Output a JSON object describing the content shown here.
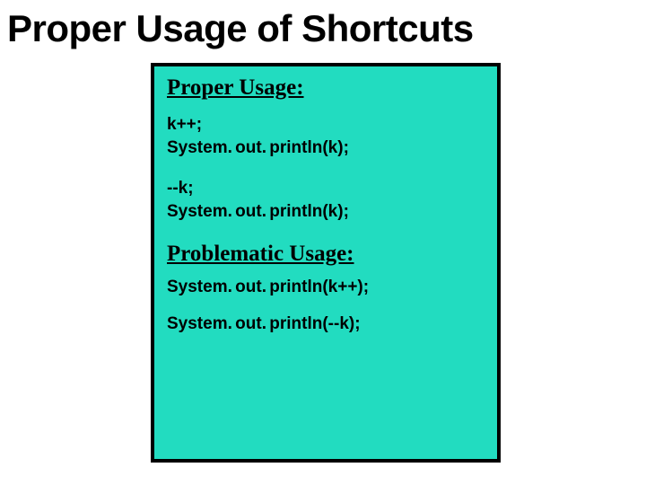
{
  "title": "Proper Usage of Shortcuts",
  "sections": {
    "proper": {
      "heading": "Proper Usage:",
      "block1": {
        "line1": "k++;",
        "line2": "System. out. println(k);"
      },
      "block2": {
        "line1": "--k;",
        "line2": "System. out. println(k);"
      }
    },
    "problematic": {
      "heading": "Problematic Usage:",
      "block1": {
        "line1": "System. out. println(k++);"
      },
      "block2": {
        "line1": "System. out. println(--k);"
      }
    }
  }
}
